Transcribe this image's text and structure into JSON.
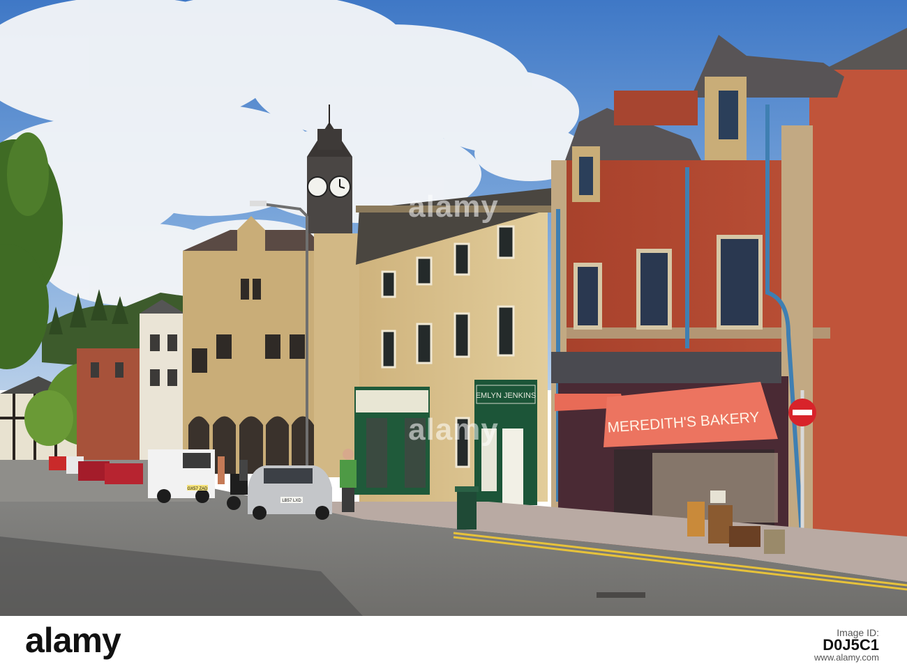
{
  "signs": {
    "bakery": "MEREDITH'S BAKERY",
    "jenkins": "EMLYN JENKINS",
    "plate_van": "GX57 ZAD",
    "plate_car": "LB57 LXD"
  },
  "watermarks": {
    "top": "alamy",
    "middle": "alamy"
  },
  "footer": {
    "logo": "alamy",
    "image_id_label": "Image ID:",
    "image_id": "D0J5C1",
    "site": "www.alamy.com"
  },
  "colors": {
    "sky": "#5b8fd0",
    "brick": "#b1452e",
    "stone": "#d8c08c",
    "awning": "#e86b57",
    "shopfront_green": "#1f5a3a"
  }
}
